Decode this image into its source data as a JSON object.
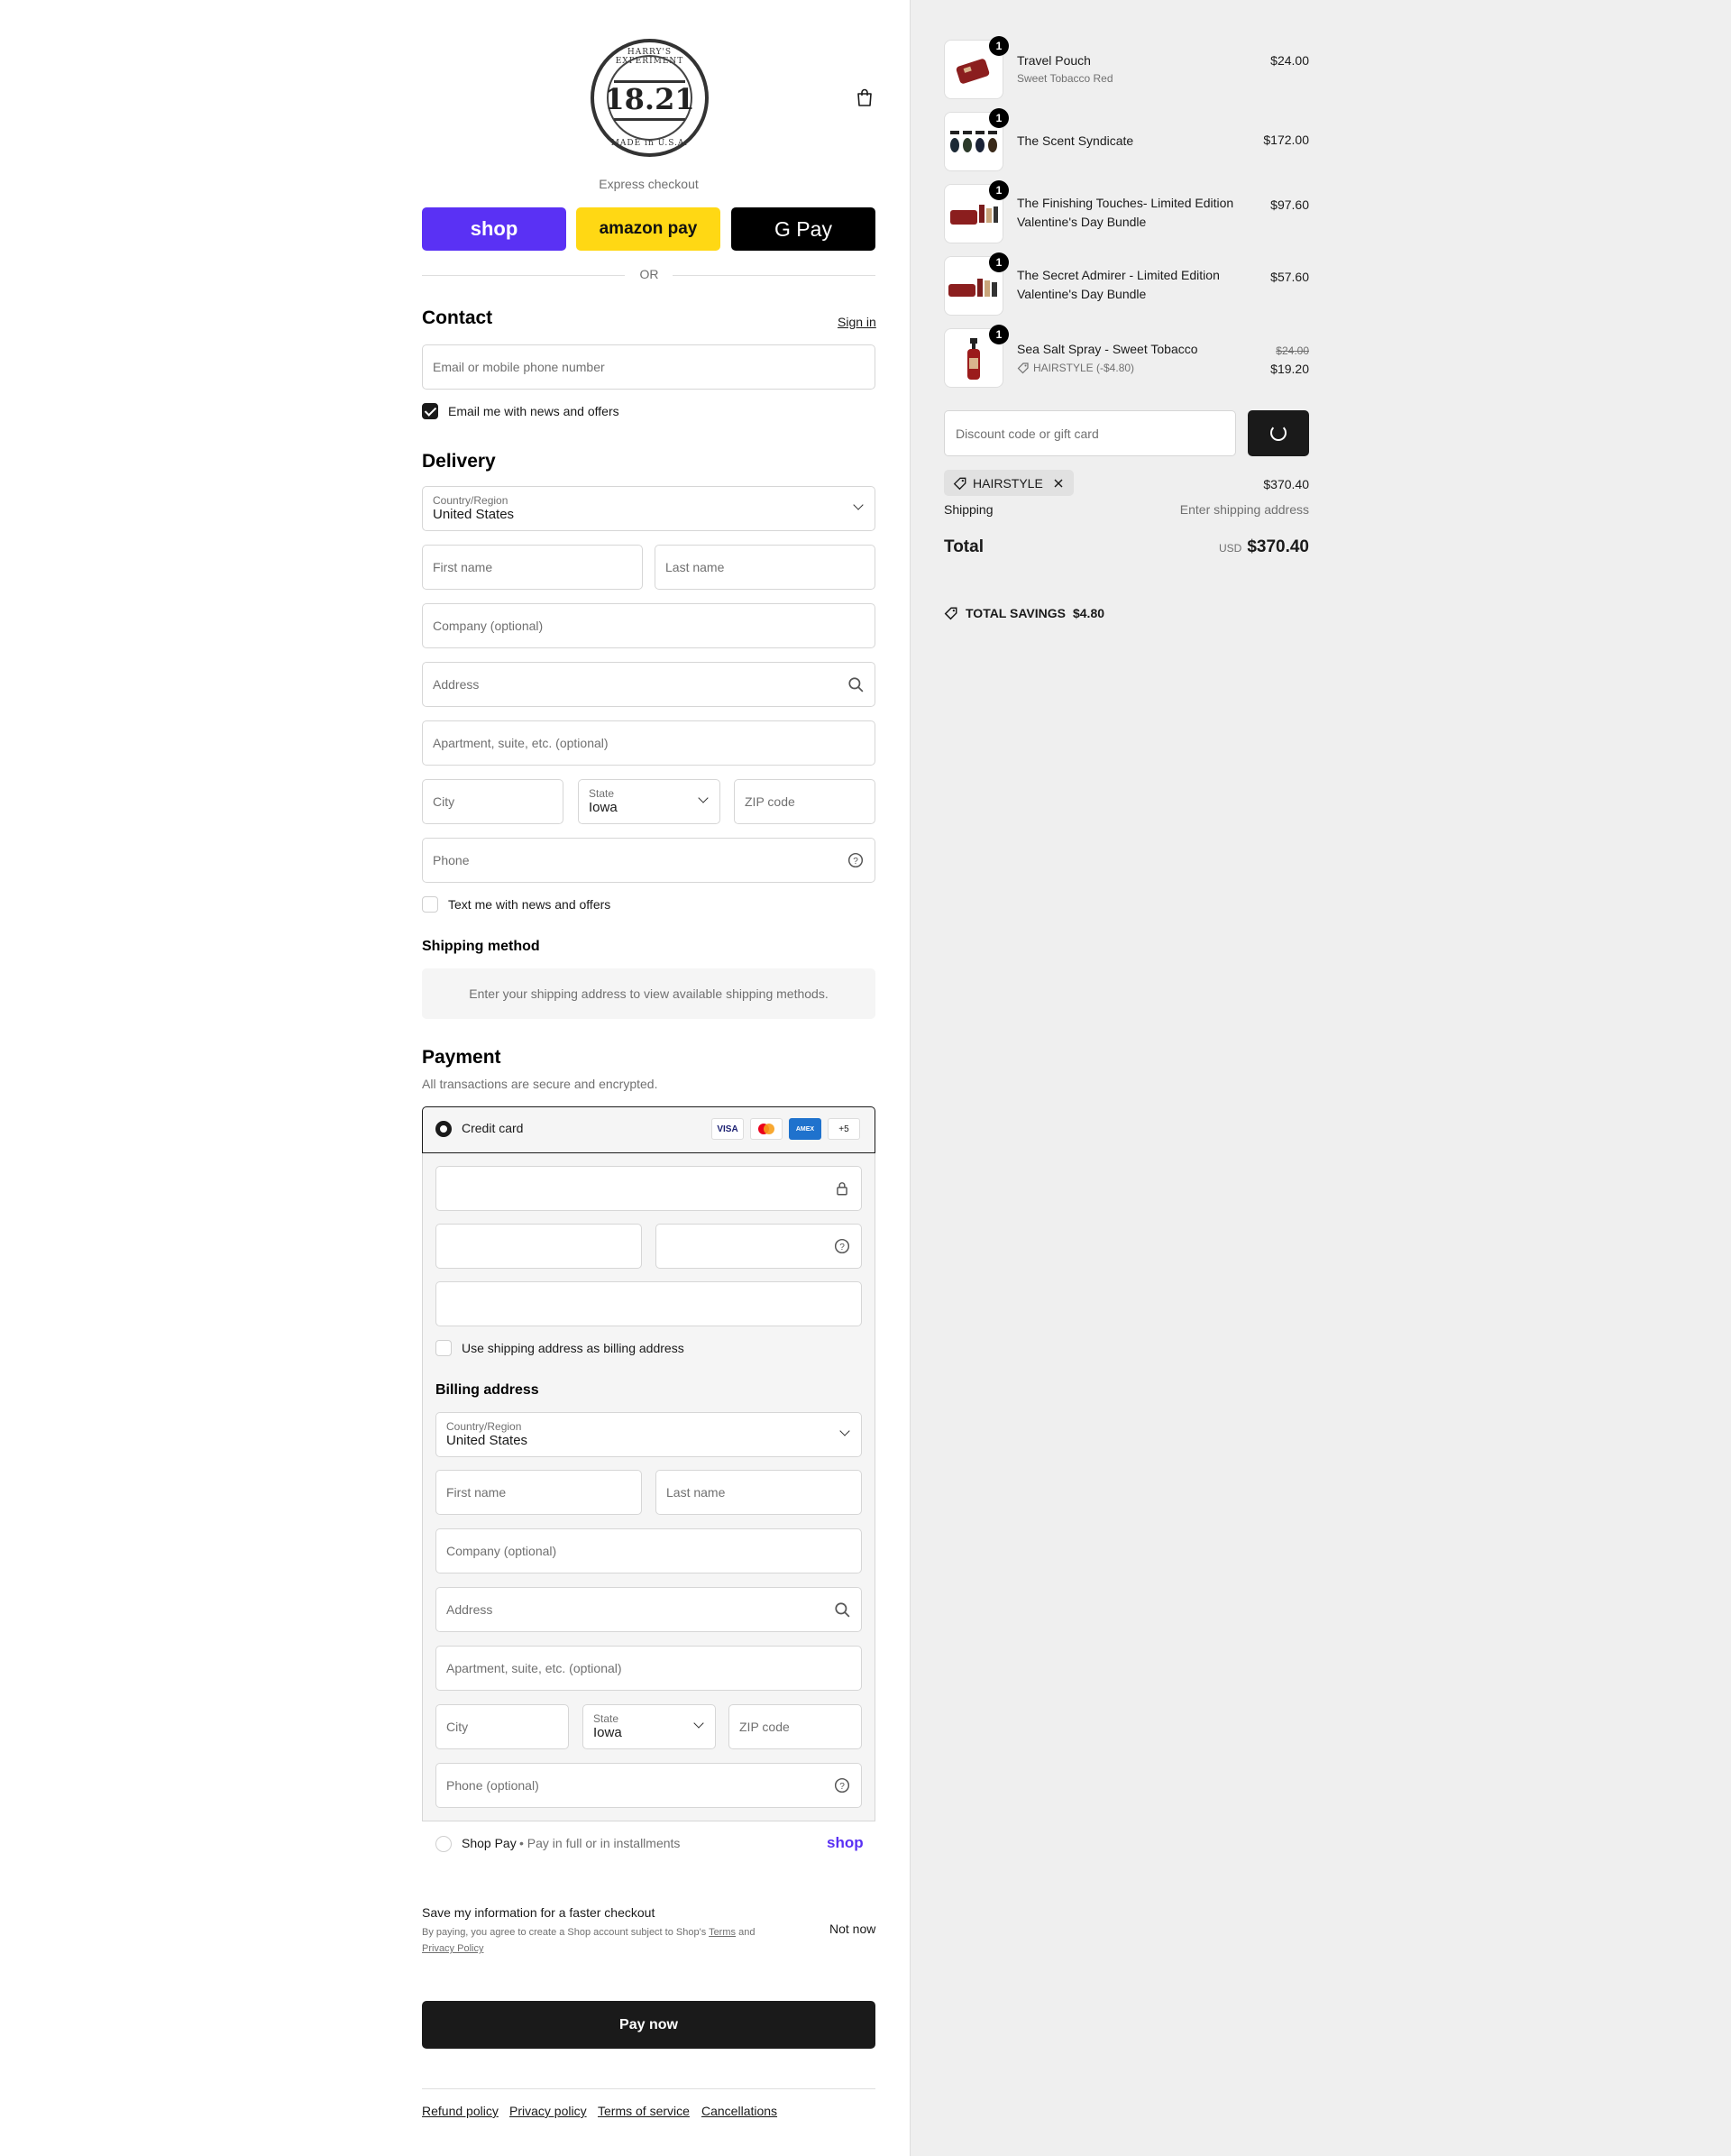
{
  "logo": {
    "text_top": "HARRY'S EXPERIMENT",
    "number": "18.21",
    "text_bottom": "MADE in U.S.A."
  },
  "express": {
    "label": "Express checkout",
    "shop": "shop",
    "amazon": "amazon pay",
    "gpay": "G Pay",
    "or": "OR"
  },
  "contact": {
    "title": "Contact",
    "sign_in": "Sign in",
    "email_placeholder": "Email or mobile phone number",
    "news_label": "Email me with news and offers",
    "news_checked": true
  },
  "delivery": {
    "title": "Delivery",
    "country_label": "Country/Region",
    "country_value": "United States",
    "first_name": "First name",
    "last_name": "Last name",
    "company": "Company (optional)",
    "address": "Address",
    "apartment": "Apartment, suite, etc. (optional)",
    "city": "City",
    "state_label": "State",
    "state_value": "Iowa",
    "zip": "ZIP code",
    "phone": "Phone",
    "sms_label": "Text me with news and offers"
  },
  "shipping_method": {
    "title": "Shipping method",
    "message": "Enter your shipping address to view available shipping methods."
  },
  "payment": {
    "title": "Payment",
    "subtitle": "All transactions are secure and encrypted.",
    "credit_card": "Credit card",
    "cards": [
      "VISA",
      "MC",
      "AMEX",
      "+5"
    ],
    "billing_checkbox": "Use shipping address as billing address",
    "billing_title": "Billing address",
    "billing": {
      "country_label": "Country/Region",
      "country_value": "United States",
      "first_name": "First name",
      "last_name": "Last name",
      "company": "Company (optional)",
      "address": "Address",
      "apartment": "Apartment, suite, etc. (optional)",
      "city": "City",
      "state_label": "State",
      "state_value": "Iowa",
      "zip": "ZIP code",
      "phone": "Phone (optional)"
    },
    "shop_pay": "Shop Pay",
    "shop_pay_note": "• Pay in full or in installments",
    "shop_logo": "shop"
  },
  "save_info": {
    "title": "Save my information for a faster checkout",
    "text_1": "By paying, you agree to create a Shop account subject to Shop's",
    "terms": "Terms",
    "and": "and",
    "privacy": "Privacy Policy",
    "not_now": "Not now"
  },
  "pay_now": "Pay now",
  "footer": [
    "Refund policy",
    "Privacy policy",
    "Terms of service",
    "Cancellations"
  ],
  "order": {
    "items": [
      {
        "qty": "1",
        "name": "Travel Pouch",
        "variant": "Sweet Tobacco Red",
        "price": "$24.00"
      },
      {
        "qty": "1",
        "name": "The Scent Syndicate",
        "price": "$172.00"
      },
      {
        "qty": "1",
        "name": "The Finishing Touches- Limited Edition Valentine's Day Bundle",
        "price": "$97.60"
      },
      {
        "qty": "1",
        "name": "The Secret Admirer - Limited Edition Valentine's Day Bundle",
        "price": "$57.60"
      },
      {
        "qty": "1",
        "name": "Sea Salt Spray - Sweet Tobacco",
        "discount": "HAIRSTYLE (-$4.80)",
        "original_price": "$24.00",
        "price": "$19.20"
      }
    ],
    "discount_placeholder": "Discount code or gift card",
    "applied_code": "HAIRSTYLE",
    "subtotal": "$370.40",
    "shipping_label": "Shipping",
    "shipping_value": "Enter shipping address",
    "total_label": "Total",
    "currency": "USD",
    "total": "$370.40",
    "savings_label": "TOTAL SAVINGS",
    "savings_value": "$4.80"
  },
  "colors": {
    "shop_purple": "#5a31f4",
    "amazon_yellow": "#ffd814",
    "dark": "#1a1a1a",
    "summary_bg": "#efefef"
  }
}
